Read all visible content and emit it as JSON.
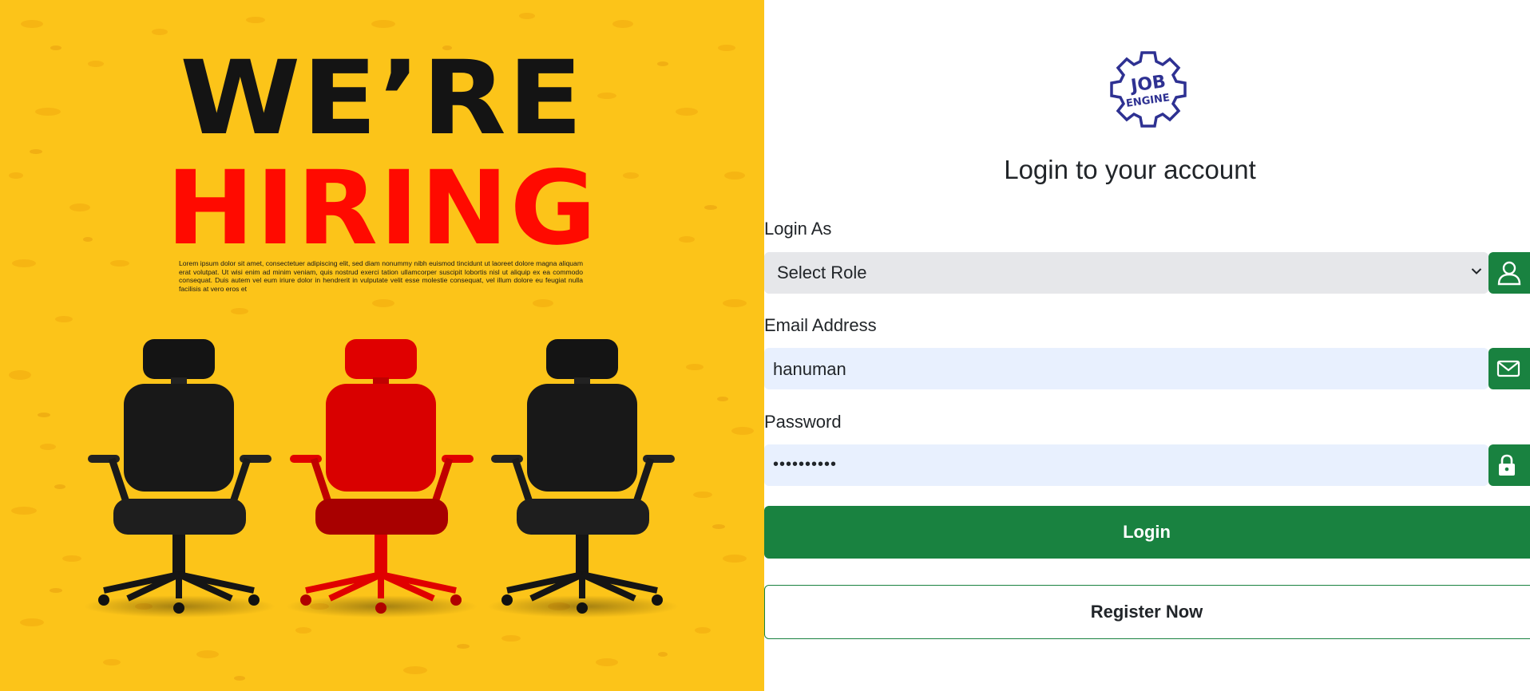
{
  "poster": {
    "headline_line1": "WE’RE",
    "headline_line2": "HIRING",
    "body_text": "Lorem ipsum dolor sit amet, consectetuer adipiscing elit, sed diam nonummy nibh euismod tincidunt ut laoreet dolore magna aliquam erat volutpat. Ut wisi enim ad minim veniam, quis nostrud exerci tation ullamcorper suscipit lobortis nisl ut aliquip ex ea commodo consequat. Duis autem vel eum iriure dolor in hendrerit in vulputate velit esse molestie consequat, vel illum dolore eu feugiat nulla facilisis at vero eros et",
    "colors": {
      "background": "#fcc419",
      "headline_dark": "#141414",
      "headline_red": "#ff0a00"
    }
  },
  "logo": {
    "line1": "JOB",
    "line2": "ENGINE",
    "color": "#2e3192"
  },
  "form": {
    "title": "Login to your account",
    "role": {
      "label": "Login As",
      "selected": "Select Role",
      "icon": "person-icon"
    },
    "email": {
      "label": "Email Address",
      "value": "hanuman",
      "icon": "envelope-icon"
    },
    "password": {
      "label": "Password",
      "value": "••••••••••",
      "icon": "lock-icon"
    },
    "login_button": "Login",
    "register_button": "Register Now",
    "colors": {
      "accent": "#198240",
      "input_autofill": "#e8f0fe",
      "select_bg": "#e6e7ea"
    }
  }
}
